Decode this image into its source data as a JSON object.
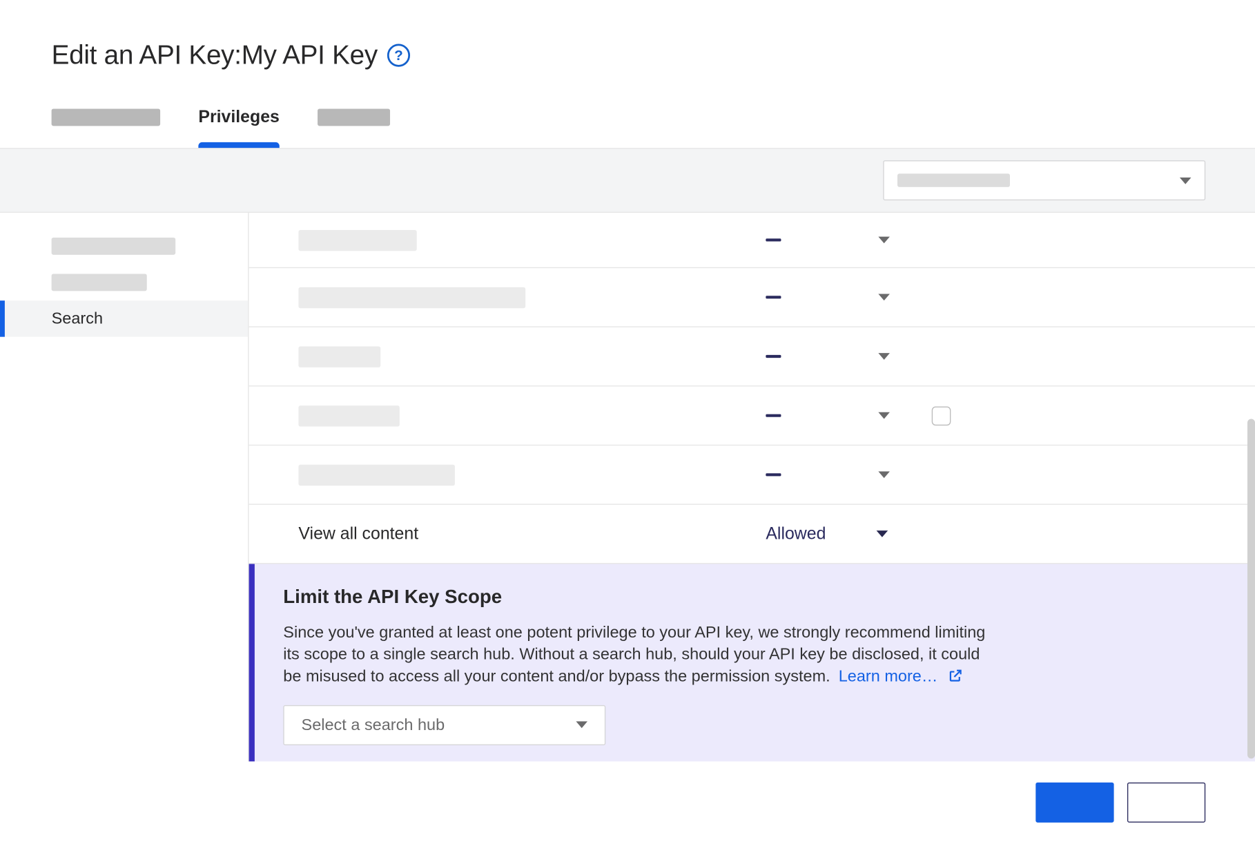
{
  "header": {
    "title_prefix": "Edit an API Key: ",
    "key_name": "My API Key"
  },
  "tabs": {
    "placeholder0_w": 114,
    "active_label": "Privileges",
    "placeholder2_w": 76
  },
  "topbar": {
    "placeholder_w": 118
  },
  "sidebar": {
    "item0_w": 130,
    "item1_w": 100,
    "active_label": "Search"
  },
  "priv_rows": [
    {
      "placeholder_w": 124,
      "dash": true,
      "checkbox": false
    },
    {
      "placeholder_w": 238,
      "dash": true,
      "checkbox": false
    },
    {
      "placeholder_w": 86,
      "dash": true,
      "checkbox": false
    },
    {
      "placeholder_w": 106,
      "dash": true,
      "checkbox": true
    },
    {
      "placeholder_w": 164,
      "dash": true,
      "checkbox": false
    }
  ],
  "priv_last": {
    "label": "View all content",
    "value": "Allowed"
  },
  "info": {
    "title": "Limit the API Key Scope",
    "body": "Since you've granted at least one potent privilege to your API key, we strongly recommend limiting its scope to a single search hub. Without a search hub, should your API key be disclosed, it could be misused to access all your content and/or bypass the permission system.",
    "link_text": "Learn more…",
    "hub_placeholder": "Select a search hub"
  }
}
